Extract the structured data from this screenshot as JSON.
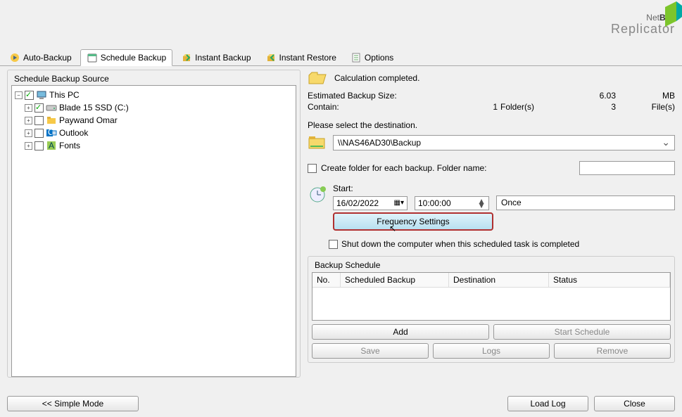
{
  "branding": {
    "name1": "Net",
    "name2": "Bak",
    "sub": "Replicator"
  },
  "tabs": {
    "auto": "Auto-Backup",
    "schedule": "Schedule Backup",
    "instant": "Instant Backup",
    "restore": "Instant Restore",
    "options": "Options"
  },
  "source": {
    "title": "Schedule Backup Source",
    "nodes": [
      {
        "label": "This PC",
        "icon": "pc",
        "checked": true,
        "indent": 0
      },
      {
        "label": "Blade 15 SSD (C:)",
        "icon": "drive",
        "checked": true,
        "indent": 1
      },
      {
        "label": "Paywand Omar",
        "icon": "folder",
        "checked": false,
        "indent": 1
      },
      {
        "label": "Outlook",
        "icon": "outlook",
        "checked": false,
        "indent": 1
      },
      {
        "label": "Fonts",
        "icon": "fonts",
        "checked": false,
        "indent": 1
      }
    ]
  },
  "calc": {
    "completed": "Calculation completed.",
    "est_label": "Estimated Backup Size:",
    "est_val": "6.03",
    "est_unit": "MB",
    "contain_label": "Contain:",
    "folders_count": "1",
    "folders_label": "Folder(s)",
    "files_count": "3",
    "files_label": "File(s)"
  },
  "dest": {
    "label": "Please select the destination.",
    "value": "\\\\NAS46AD30\\Backup"
  },
  "create_folder": {
    "label": "Create folder for each backup. Folder name:",
    "value": ""
  },
  "start": {
    "label": "Start:",
    "date": "16/02/2022",
    "time": "10:00:00",
    "freq_value": "Once",
    "freq_btn": "Frequency Settings",
    "shutdown": "Shut down the computer when this scheduled task is completed"
  },
  "schedule": {
    "title": "Backup Schedule",
    "cols": {
      "no": "No.",
      "sb": "Scheduled Backup",
      "de": "Destination",
      "st": "Status"
    },
    "buttons": {
      "add": "Add",
      "start": "Start Schedule",
      "save": "Save",
      "logs": "Logs",
      "remove": "Remove"
    }
  },
  "footer": {
    "simple": "<<  Simple Mode",
    "load": "Load Log",
    "close": "Close"
  }
}
